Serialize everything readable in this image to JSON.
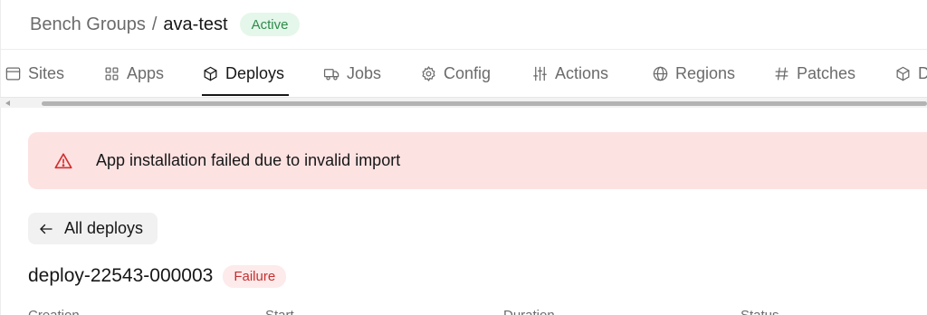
{
  "breadcrumb": {
    "parent": "Bench Groups",
    "separator": "/",
    "current": "ava-test",
    "status": "Active"
  },
  "tabs": [
    {
      "label": "Sites",
      "icon": "browser-window-icon"
    },
    {
      "label": "Apps",
      "icon": "grid-icon"
    },
    {
      "label": "Deploys",
      "icon": "package-icon",
      "active": true
    },
    {
      "label": "Jobs",
      "icon": "truck-icon"
    },
    {
      "label": "Config",
      "icon": "gear-icon"
    },
    {
      "label": "Actions",
      "icon": "sliders-icon"
    },
    {
      "label": "Regions",
      "icon": "globe-icon"
    },
    {
      "label": "Patches",
      "icon": "hash-icon"
    },
    {
      "label": "D",
      "icon": "package-icon"
    }
  ],
  "alert": {
    "icon": "warning-triangle-icon",
    "message": "App installation failed due to invalid import"
  },
  "back_button": {
    "icon": "arrow-left-icon",
    "label": "All deploys"
  },
  "deploy": {
    "name": "deploy-22543-000003",
    "status": "Failure"
  },
  "table_headers": [
    "Creation",
    "Start",
    "Duration",
    "Status"
  ],
  "colors": {
    "active_badge_bg": "#e4f7ea",
    "active_badge_text": "#2f8a4b",
    "alert_bg": "#fde2e2",
    "alert_icon": "#d32f2f",
    "failure_badge_bg": "#fdeaea",
    "failure_badge_text": "#c53030"
  }
}
